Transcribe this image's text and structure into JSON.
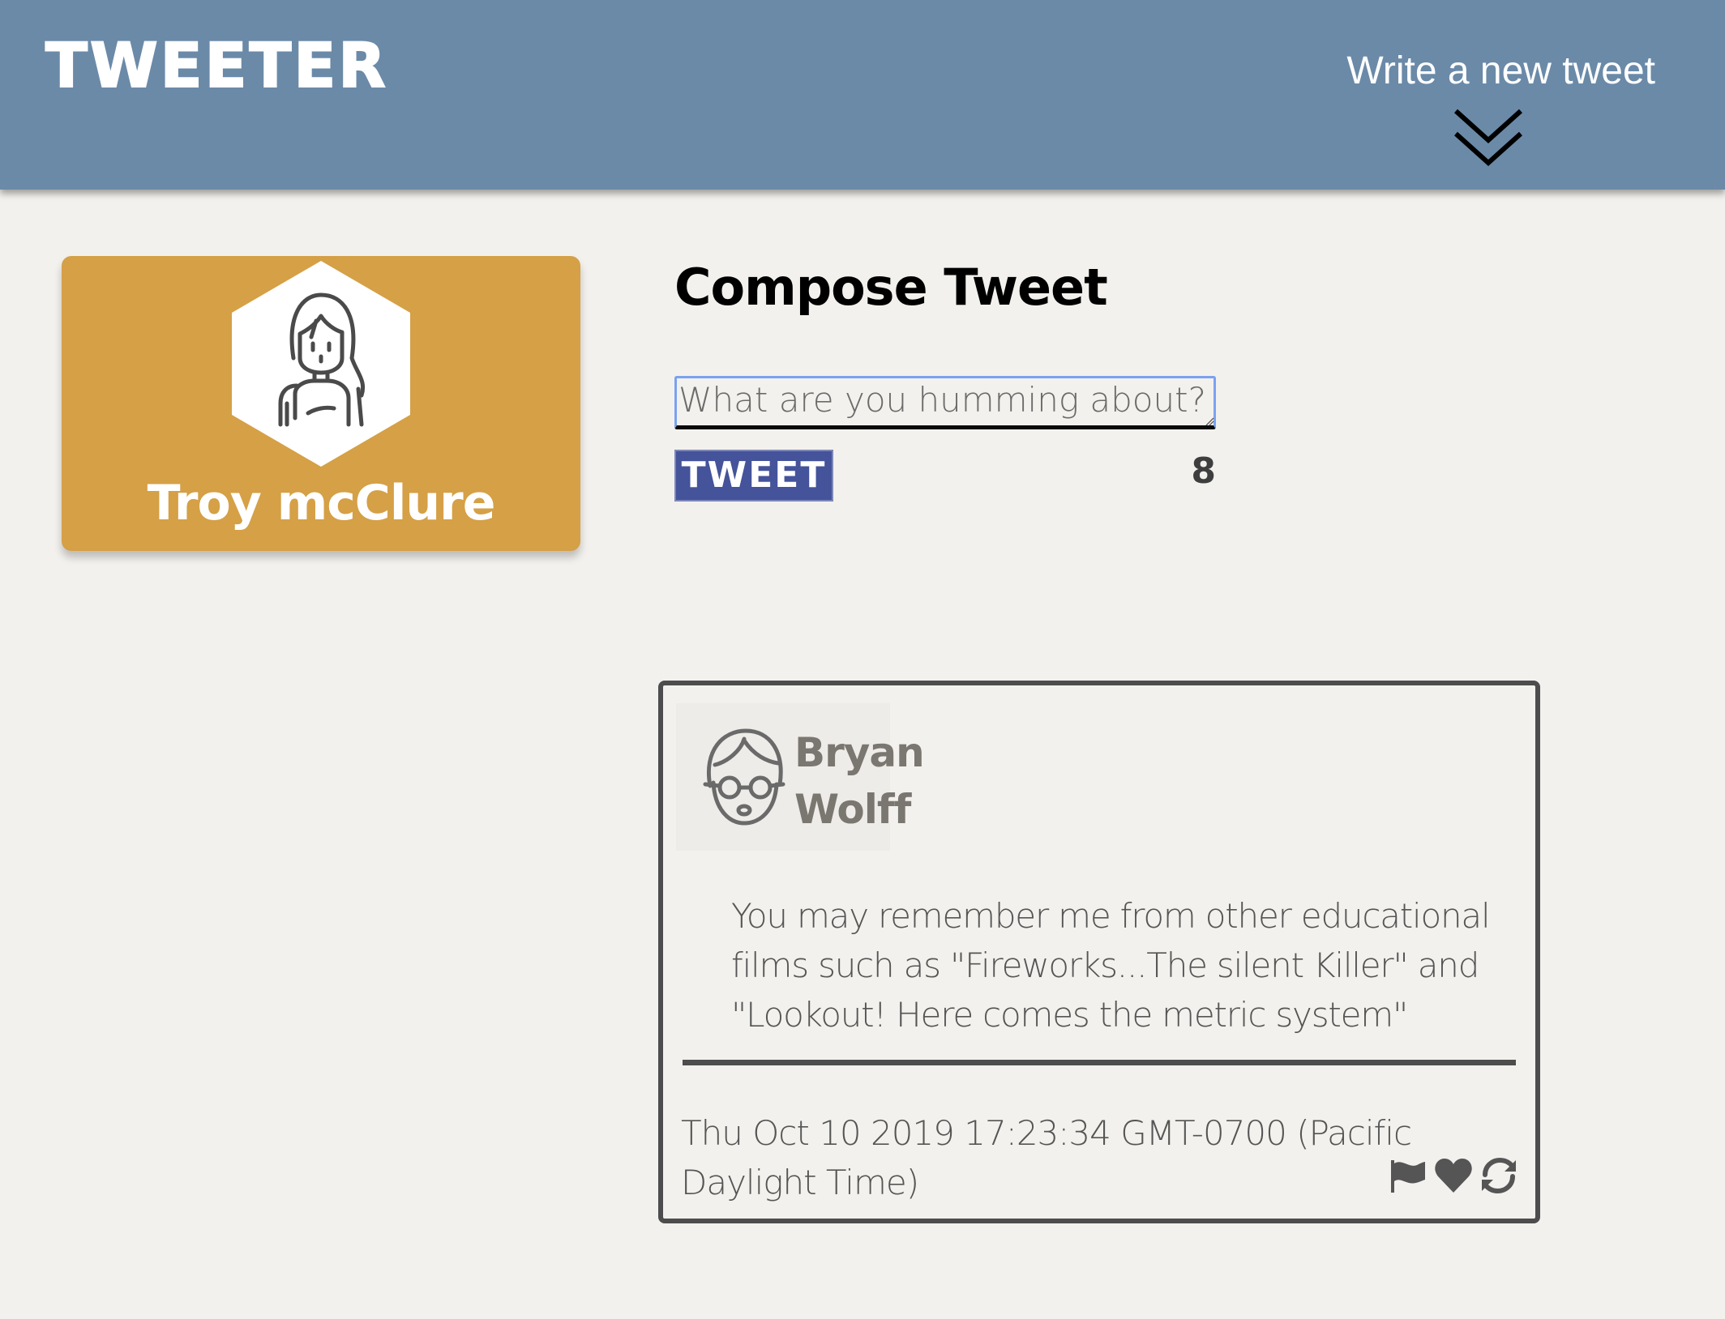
{
  "nav": {
    "brand": "TWEETER",
    "compose_label": "Write a new tweet",
    "compose_icon": "double-chevron-down-icon",
    "background": "#6b8aa8"
  },
  "profile": {
    "name": "Troy mcClure",
    "avatar_icon": "woman-avatar-icon",
    "background": "#d5a046"
  },
  "compose": {
    "title": "Compose Tweet",
    "placeholder": "What are you humming about?",
    "value": "",
    "button_label": "TWEET",
    "char_counter": "8",
    "button_color": "#44539a"
  },
  "tweets": [
    {
      "author_first": "Bryan",
      "author_last": "Wolff",
      "avatar_icon": "man-with-glasses-avatar-icon",
      "body": "You may remember me from other educational films such as \"Fireworks...The silent Killer\" and \"Lookout! Here comes the metric system\"",
      "timestamp": "Thu Oct 10 2019 17:23:34 GMT-0700 (Pacific Daylight Time)",
      "actions": [
        "flag-icon",
        "heart-icon",
        "retweet-icon"
      ]
    }
  ]
}
